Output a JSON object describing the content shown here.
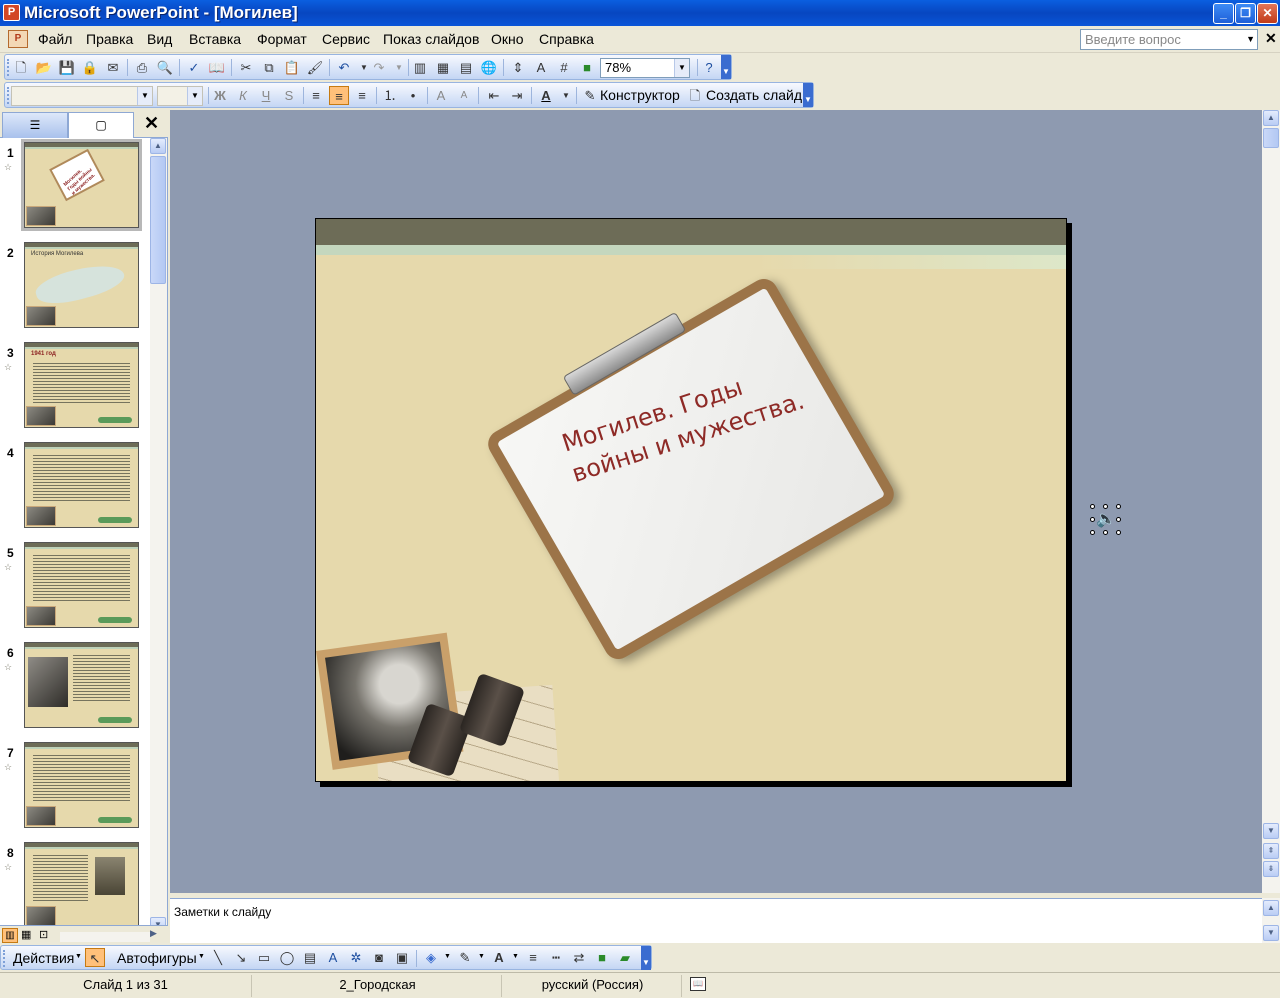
{
  "window": {
    "title": "Microsoft PowerPoint - [Могилев]",
    "app_icon": "P",
    "minimize": "_",
    "restore": "❐",
    "close": "✕"
  },
  "menu": {
    "items": [
      "Файл",
      "Правка",
      "Вид",
      "Вставка",
      "Формат",
      "Сервис",
      "Показ слайдов",
      "Окно",
      "Справка"
    ],
    "ask_placeholder": "Введите вопрос",
    "close_doc": "✕"
  },
  "toolbar_standard": {
    "zoom": "78%"
  },
  "toolbar_formatting": {
    "font_name": "",
    "font_size": "",
    "bold": "Ж",
    "italic": "К",
    "underline": "Ч",
    "shadow": "S",
    "designer_label": "Конструктор",
    "new_slide_label": "Создать слайд"
  },
  "left_pane": {
    "tab_outline_icon": "outline-icon",
    "tab_slides_icon": "slides-icon",
    "close": "✕",
    "thumbnails": [
      {
        "number": "1",
        "title": "Могилев. Годы войны и мужества.",
        "kind": "title",
        "selected": true
      },
      {
        "number": "2",
        "title": "История Могилева",
        "kind": "map"
      },
      {
        "number": "3",
        "title": "1941 год",
        "kind": "text"
      },
      {
        "number": "4",
        "title": "",
        "kind": "text"
      },
      {
        "number": "5",
        "title": "",
        "kind": "text"
      },
      {
        "number": "6",
        "title": "",
        "kind": "photo"
      },
      {
        "number": "7",
        "title": "",
        "kind": "text"
      },
      {
        "number": "8",
        "title": "",
        "kind": "portrait"
      }
    ]
  },
  "slide": {
    "title_line1": "Могилев. Годы",
    "title_line2": "войны и мужества.",
    "sound_object": "speaker-icon"
  },
  "notes": {
    "placeholder": "Заметки к слайду"
  },
  "draw_toolbar": {
    "actions_label": "Действия",
    "autoshapes_label": "Автофигуры"
  },
  "status_bar": {
    "slide_info": "Слайд 1 из 31",
    "design": "2_Городская",
    "language": "русский (Россия)"
  },
  "colors": {
    "titlebar": "#0A5FE0",
    "workspace": "#8E9AB0",
    "slide_background": "#E6D9AC",
    "slide_title": "#8E2A26"
  }
}
